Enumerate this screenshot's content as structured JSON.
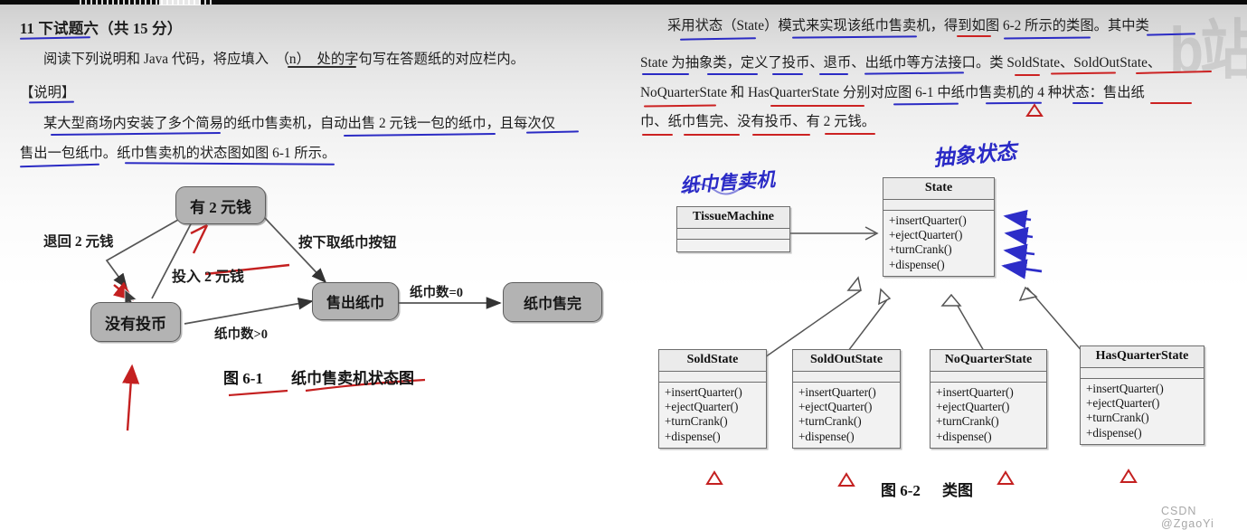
{
  "page": {
    "watermark": "CSDN @ZgaoYi",
    "background_top": "#c9c9c9",
    "background_bottom": "#ffffff",
    "pen_blue": "#2b2bc4",
    "pen_red": "#cc2222"
  },
  "left_column": {
    "heading": "11 下试题六（共 15 分）",
    "paragraphs": [
      "阅读下列说明和 Java 代码，将应填入　（n）　处的字句写在答题纸的对应栏内。",
      "【说明】",
      "某大型商场内安装了多个简易的纸巾售卖机，自动出售 2 元钱一包的纸巾，且每次仅",
      "售出一包纸巾。纸巾售卖机的状态图如图 6-1 所示。"
    ],
    "blank_marker": "（n）"
  },
  "right_column": {
    "paragraphs": [
      "采用状态（State）模式来实现该纸巾售卖机，得到如图 6-2 所示的类图。其中类",
      "State 为抽象类，定义了投币、退币、出纸巾等方法接口。类 SoldState、SoldOutState、",
      "NoQuarterState 和 HasQuarterState 分别对应图 6-1 中纸巾售卖机的 4 种状态：售出纸",
      "巾、纸巾售完、没有投币、有 2 元钱。"
    ]
  },
  "figure1": {
    "caption_number": "图 6-1",
    "caption_title": "纸巾售卖机状态图",
    "states": [
      {
        "id": "has-money",
        "label": "有 2 元钱"
      },
      {
        "id": "no-coin",
        "label": "没有投币"
      },
      {
        "id": "sold",
        "label": "售出纸巾"
      },
      {
        "id": "sold-out",
        "label": "纸巾售完"
      }
    ],
    "transitions": [
      {
        "id": "refund",
        "label": "退回 2 元钱",
        "from": "has-money",
        "to": "no-coin"
      },
      {
        "id": "insert",
        "label": "投入 2 元钱",
        "from": "no-coin",
        "to": "has-money"
      },
      {
        "id": "press",
        "label": "按下取纸巾按钮",
        "from": "has-money",
        "to": "sold"
      },
      {
        "id": "count-gt0",
        "label": "纸巾数>0",
        "from": "no-coin",
        "to": "sold"
      },
      {
        "id": "count-eq0",
        "label": "纸巾数=0",
        "from": "sold",
        "to": "sold-out"
      }
    ]
  },
  "figure2": {
    "caption_number": "图 6-2",
    "caption_title": "类图",
    "handwriting": [
      {
        "id": "tissue-machine-note",
        "text": "纸巾售卖机"
      },
      {
        "id": "abstract-state-note",
        "text": "抽象状态"
      }
    ],
    "classes": [
      {
        "id": "tissue-machine",
        "name": "TissueMachine",
        "operations": []
      },
      {
        "id": "state",
        "name": "State",
        "operations": [
          "+insertQuarter()",
          "+ejectQuarter()",
          "+turnCrank()",
          "+dispense()"
        ]
      },
      {
        "id": "sold-state",
        "name": "SoldState",
        "operations": [
          "+insertQuarter()",
          "+ejectQuarter()",
          "+turnCrank()",
          "+dispense()"
        ]
      },
      {
        "id": "sold-out-state",
        "name": "SoldOutState",
        "operations": [
          "+insertQuarter()",
          "+ejectQuarter()",
          "+turnCrank()",
          "+dispense()"
        ]
      },
      {
        "id": "no-quarter-state",
        "name": "NoQuarterState",
        "operations": [
          "+insertQuarter()",
          "+ejectQuarter()",
          "+turnCrank()",
          "+dispense()"
        ]
      },
      {
        "id": "has-quarter-state",
        "name": "HasQuarterState",
        "operations": [
          "+insertQuarter()",
          "+ejectQuarter()",
          "+turnCrank()",
          "+dispense()"
        ]
      }
    ]
  }
}
